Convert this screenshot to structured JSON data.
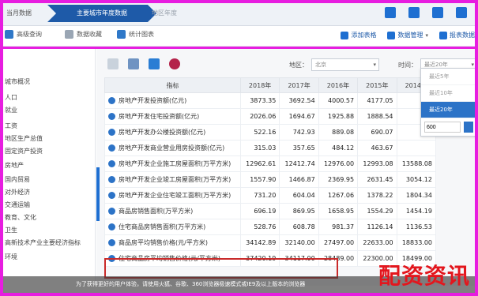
{
  "tabs": {
    "first": "当月数据",
    "active": "主要城市年度数据",
    "second": "地区年度"
  },
  "toolbar": {
    "left": [
      {
        "label": "高级查询"
      },
      {
        "label": "数据收藏"
      },
      {
        "label": "统计图表"
      }
    ],
    "add_table": "添加表格",
    "data_manage": "数据管理",
    "report": "报表数据"
  },
  "sidebar": {
    "items": [
      "城市概况",
      "人口",
      "就业",
      "工资",
      "地区生产总值",
      "固定资产投资",
      "房地产",
      "国内贸易",
      "对外经济",
      "交通运输",
      "教育、文化",
      "卫生",
      "高新技术产业主要经济指标",
      "环境"
    ]
  },
  "filters": {
    "region_label": "地区：",
    "region_value": "北京",
    "time_label": "时间：",
    "time_value": "最近20年"
  },
  "table": {
    "headers": [
      "指标",
      "2018年",
      "2017年",
      "2016年",
      "2015年",
      "2014年"
    ],
    "rows": [
      {
        "name": "房地产开发投资额(亿元)",
        "values": [
          "3873.35",
          "3692.54",
          "4000.57",
          "4177.05",
          ""
        ]
      },
      {
        "name": "房地产开发住宅投资额(亿元)",
        "values": [
          "2026.06",
          "1694.67",
          "1925.88",
          "1888.54",
          ""
        ]
      },
      {
        "name": "房地产开发办公楼投资额(亿元)",
        "values": [
          "522.16",
          "742.93",
          "889.08",
          "690.07",
          ""
        ]
      },
      {
        "name": "房地产开发商业营业用房投资额(亿元)",
        "values": [
          "315.03",
          "357.65",
          "484.12",
          "463.67",
          ""
        ]
      },
      {
        "name": "房地产开发企业施工房屋面积(万平方米)",
        "values": [
          "12962.61",
          "12412.74",
          "12976.00",
          "12993.08",
          "13588.08"
        ]
      },
      {
        "name": "房地产开发企业竣工房屋面积(万平方米)",
        "values": [
          "1557.90",
          "1466.87",
          "2369.95",
          "2631.45",
          "3054.12"
        ]
      },
      {
        "name": "房地产开发企业住宅竣工面积(万平方米)",
        "values": [
          "731.20",
          "604.04",
          "1267.06",
          "1378.22",
          "1804.34"
        ]
      },
      {
        "name": "商品房销售面积(万平方米)",
        "values": [
          "696.19",
          "869.95",
          "1658.95",
          "1554.29",
          "1454.19"
        ]
      },
      {
        "name": "住宅商品房销售面积(万平方米)",
        "values": [
          "528.76",
          "608.78",
          "981.37",
          "1126.14",
          "1136.53"
        ]
      },
      {
        "name": "商品房平均销售价格(元/平方米)",
        "values": [
          "34142.89",
          "32140.00",
          "27497.00",
          "22633.00",
          "18833.00"
        ]
      },
      {
        "name": "住宅商品房平均销售价格(元/平方米)",
        "values": [
          "37420.19",
          "34117.00",
          "28489.00",
          "22300.00",
          "18499.00"
        ]
      }
    ]
  },
  "dropdown": {
    "items": [
      "最近5年",
      "最近10年",
      "最近20年"
    ],
    "active_index": 2,
    "input_value": "600"
  },
  "caption": "为了获得更好的用户体验，请使用火狐、谷歌、360浏览器极速模式或IE9及以上版本的浏览器",
  "watermark": "配资资讯"
}
